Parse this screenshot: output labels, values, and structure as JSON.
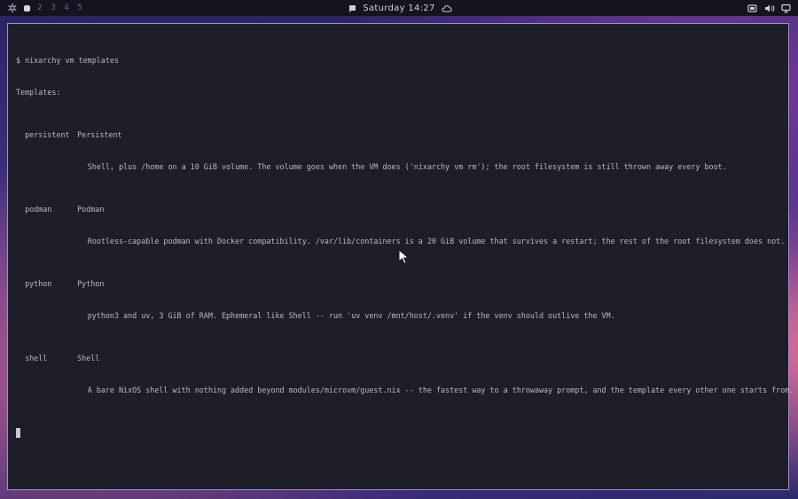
{
  "topbar": {
    "workspaces": [
      "2",
      "3",
      "4",
      "5"
    ],
    "clock": "Saturday 14:27"
  },
  "terminal": {
    "command": "$ nixarchy vm templates",
    "header": "Templates:",
    "templates": [
      {
        "id": "persistent",
        "name": "Persistent",
        "description": "Shell, plus /home on a 10 GiB volume. The volume goes when the VM does ('nixarchy vm rm'); the root filesystem is still thrown away every boot."
      },
      {
        "id": "podman",
        "name": "Podman",
        "description": "Rootless-capable podman with Docker compatibility. /var/lib/containers is a 20 GiB volume that survives a restart; the rest of the root filesystem does not."
      },
      {
        "id": "python",
        "name": "Python",
        "description": "python3 and uv, 3 GiB of RAM. Ephemeral like Shell -- run 'uv venv /mnt/host/.venv' if the venv should outlive the VM."
      },
      {
        "id": "shell",
        "name": "Shell",
        "description": "A bare NixOS shell with nothing added beyond modules/microvm/guest.nix -- the fastest way to a throwaway prompt, and the template every other one starts from."
      }
    ]
  }
}
